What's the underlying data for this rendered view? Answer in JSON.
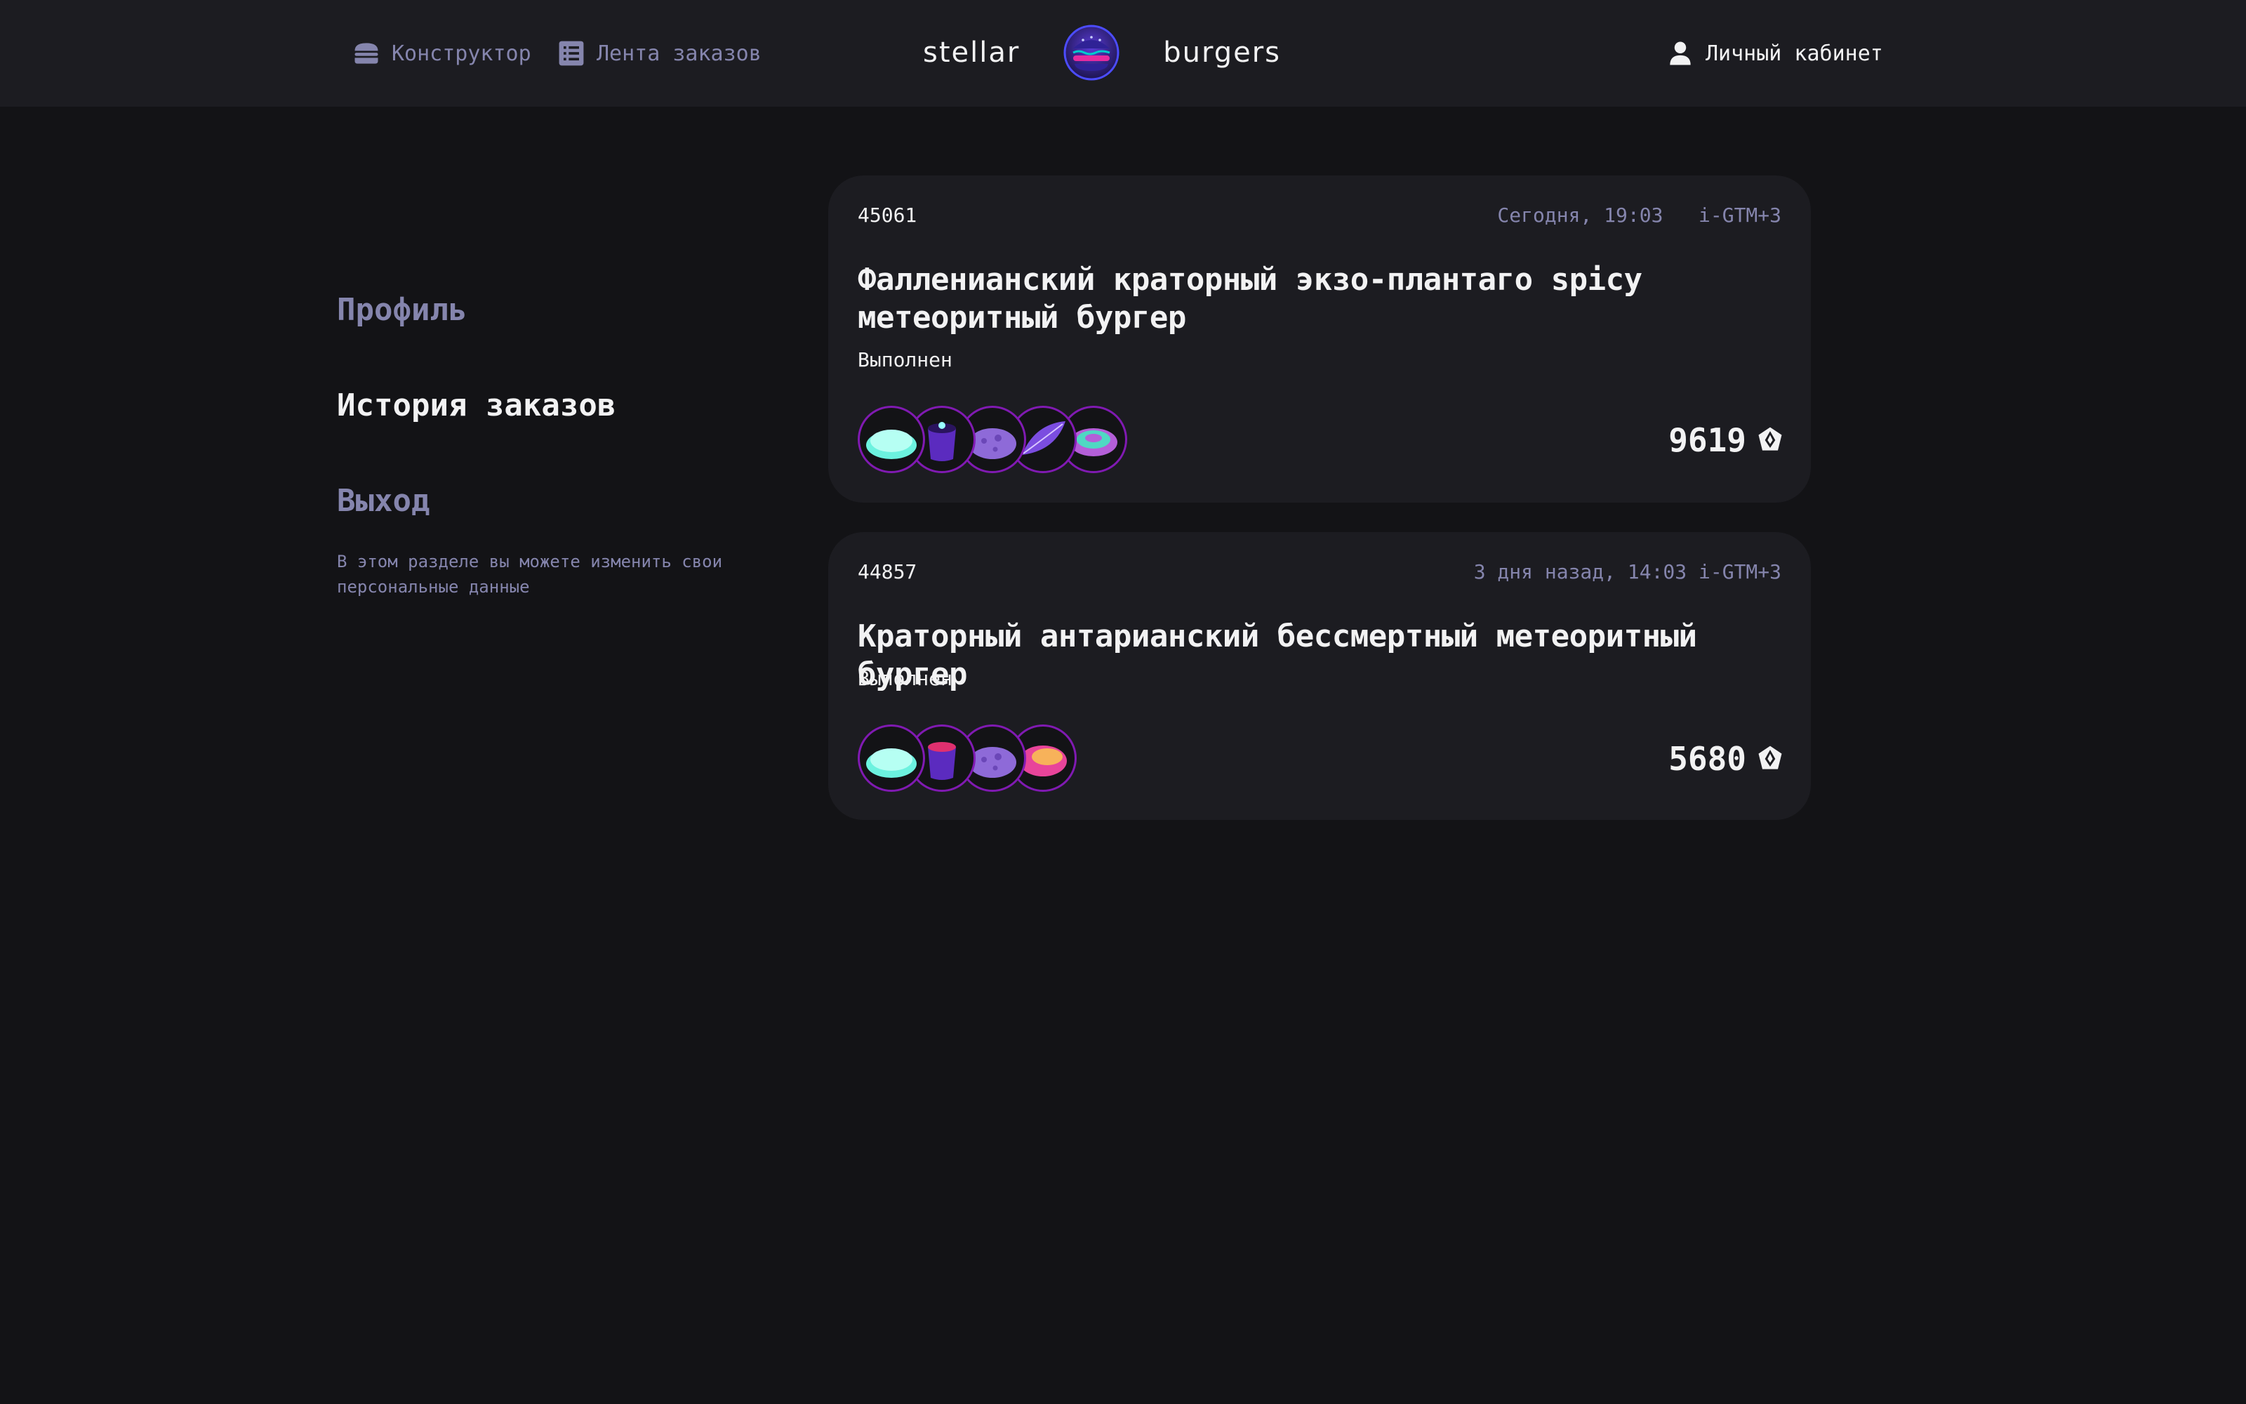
{
  "header": {
    "nav": {
      "constructor_label": "Конструктор",
      "feed_label": "Лента заказов",
      "account_label": "Личный кабинет"
    },
    "logo": {
      "left": "stellar",
      "right": "burgers"
    },
    "icons": {
      "constructor": "burger-icon",
      "feed": "list-icon",
      "account": "profile-icon",
      "logo": "planet-burger-logo"
    }
  },
  "sidebar": {
    "items": [
      {
        "label": "Профиль",
        "active": false
      },
      {
        "label": "История заказов",
        "active": true
      },
      {
        "label": "Выход",
        "active": false
      }
    ],
    "hint": "В этом разделе вы можете изменить свои персональные данные"
  },
  "orders": [
    {
      "number": "45061",
      "date": "Сегодня, 19:03   i-GTM+3",
      "title": "Фалленианский краторный экзо-плантаго spicy метеоритный бургер",
      "status": "Выполнен",
      "price": "9619",
      "ingredients": [
        "fluorescent-bun",
        "sauce-cup",
        "crater-patty",
        "leaf",
        "mineral-rings"
      ]
    },
    {
      "number": "44857",
      "date": "3 дня назад, 14:03 i-GTM+3",
      "title": "Краторный антарианский бессмертный метеоритный бургер",
      "status": "Выполнен",
      "price": "5680",
      "ingredients": [
        "fluorescent-bun",
        "sauce-cup",
        "crater-patty",
        "meteor-cheese"
      ]
    }
  ],
  "colors": {
    "background": "#131316",
    "panel": "#1c1c21",
    "text_primary": "#f2f2f3",
    "text_inactive": "#8585ad",
    "ingredient_border": "#801ab2"
  }
}
